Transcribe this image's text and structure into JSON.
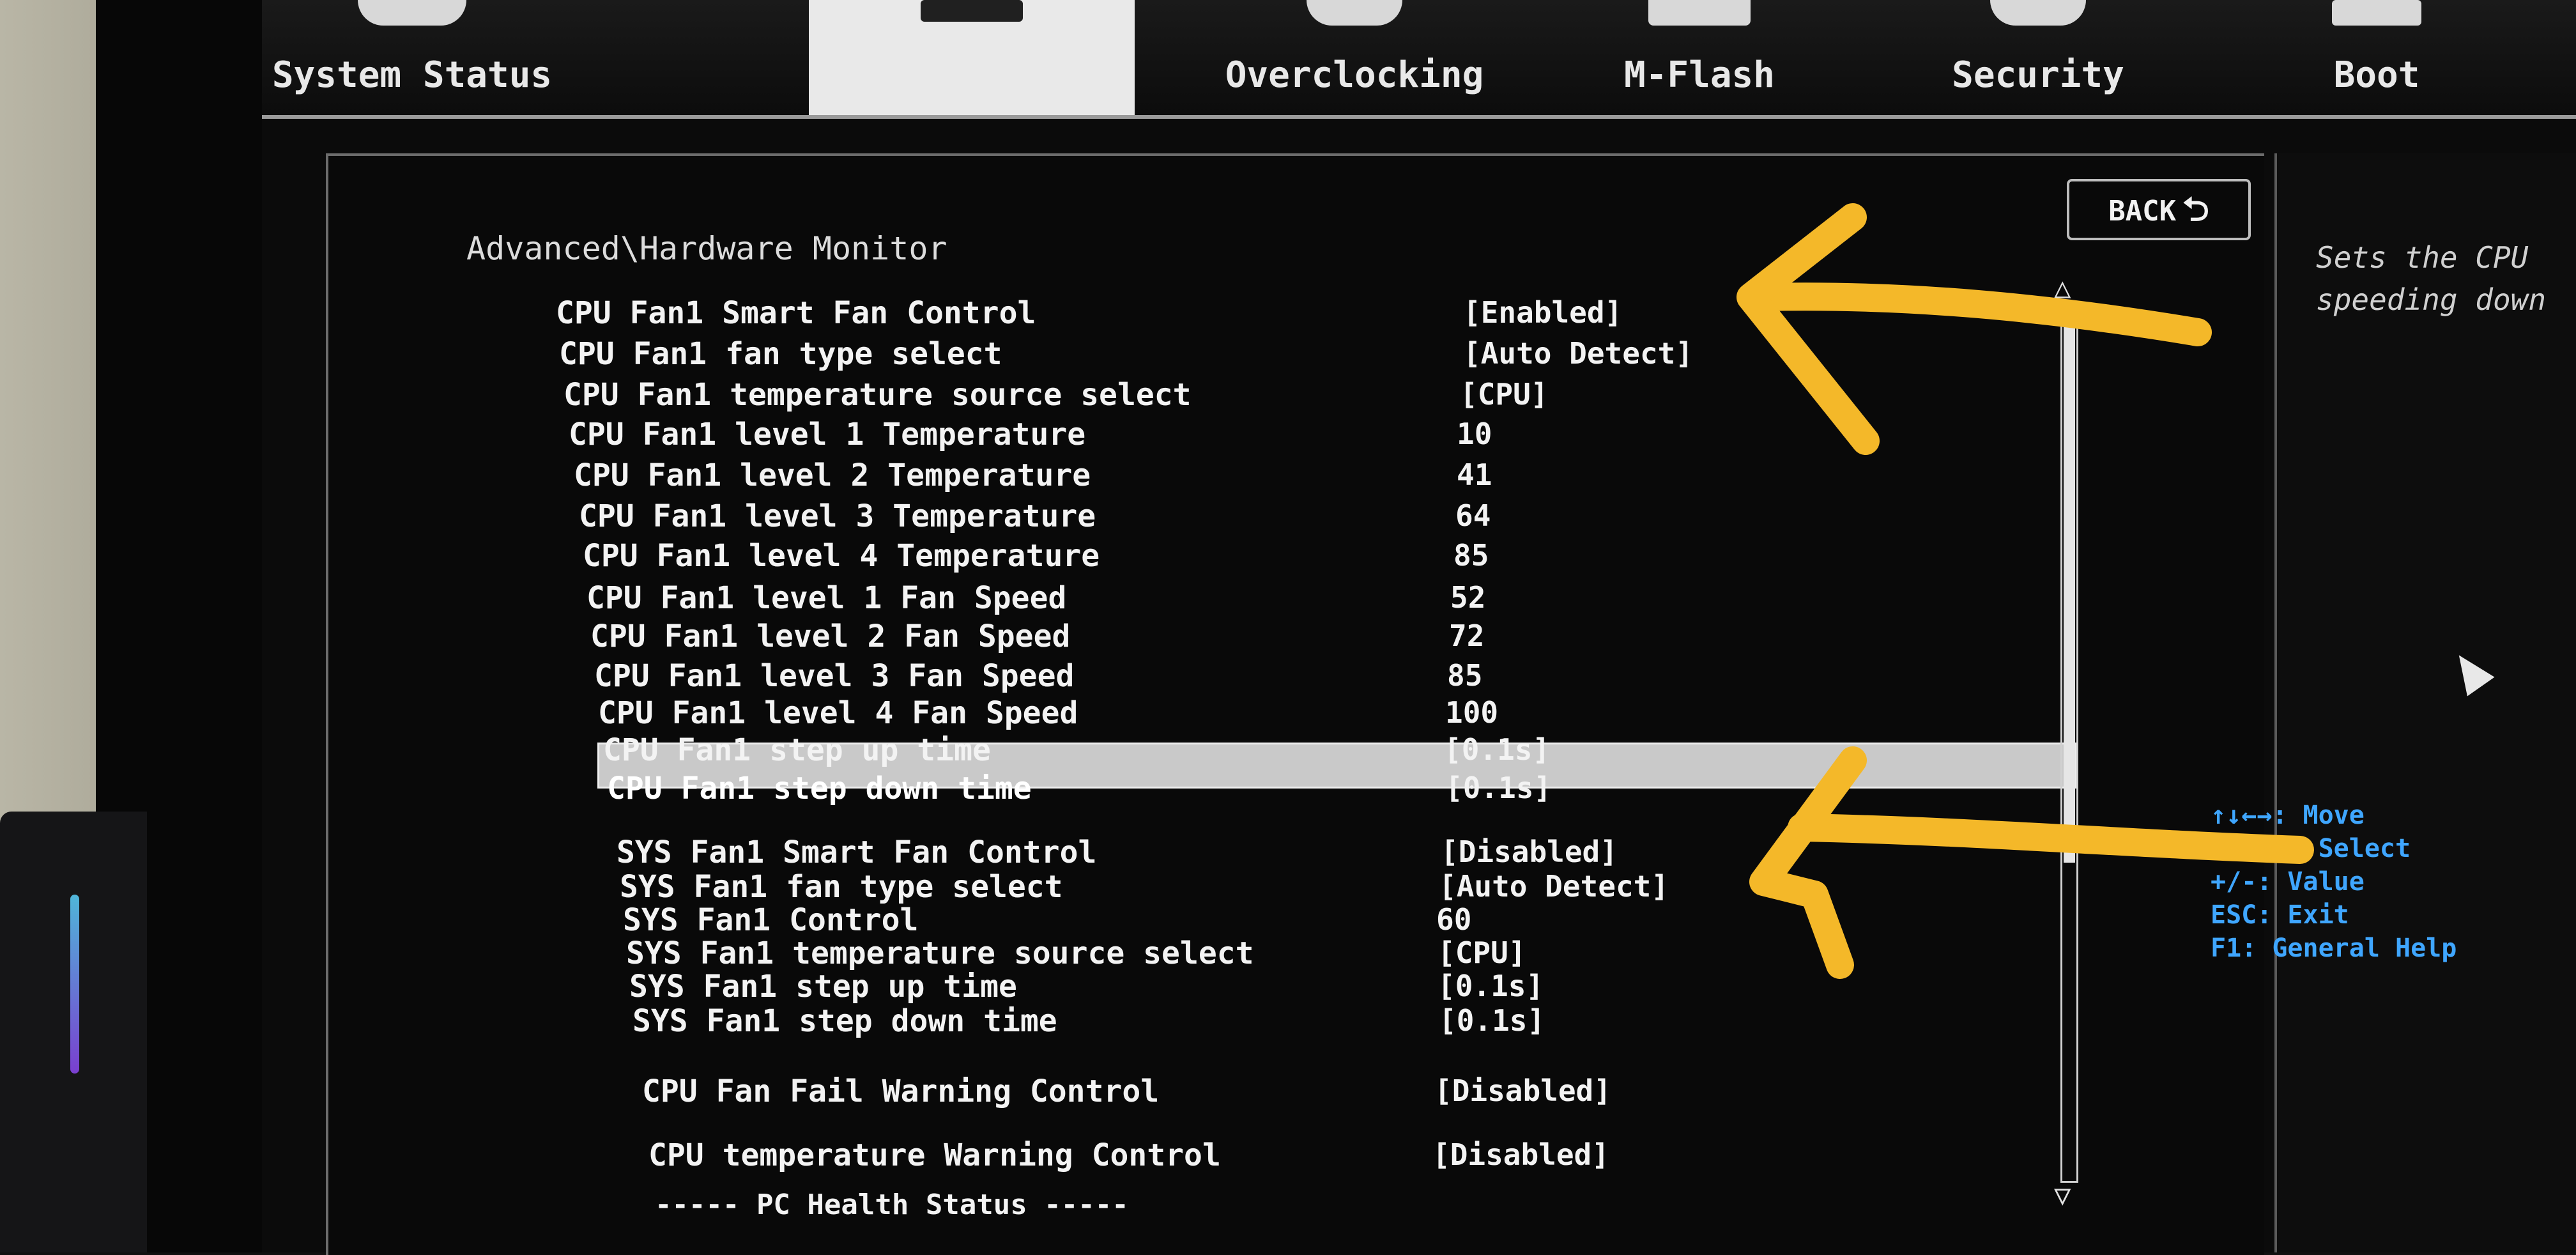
{
  "tabs": [
    {
      "label": "System Status",
      "active": false
    },
    {
      "label": "",
      "active": true
    },
    {
      "label": "Overclocking",
      "active": false
    },
    {
      "label": "M-Flash",
      "active": false
    },
    {
      "label": "Security",
      "active": false
    },
    {
      "label": "Boot",
      "active": false
    }
  ],
  "breadcrumb": "Advanced\\Hardware Monitor",
  "back_label": "BACK",
  "settings": [
    {
      "label": "CPU Fan1 Smart Fan Control",
      "value": "[Enabled]"
    },
    {
      "label": "CPU Fan1 fan type select",
      "value": "[Auto Detect]"
    },
    {
      "label": "CPU Fan1 temperature source select",
      "value": "[CPU]"
    },
    {
      "label": "CPU Fan1 level 1 Temperature",
      "value": "10"
    },
    {
      "label": "CPU Fan1 level 2 Temperature",
      "value": "41"
    },
    {
      "label": "CPU Fan1 level 3 Temperature",
      "value": "64"
    },
    {
      "label": "CPU Fan1 level 4 Temperature",
      "value": "85"
    },
    {
      "label": "CPU Fan1 level 1 Fan Speed",
      "value": "52"
    },
    {
      "label": "CPU Fan1 level 2 Fan Speed",
      "value": "72"
    },
    {
      "label": "CPU Fan1 level 3 Fan Speed",
      "value": "85"
    },
    {
      "label": "CPU Fan1 level 4 Fan Speed",
      "value": "100"
    },
    {
      "label": "CPU Fan1 step up time",
      "value": "[0.1s]"
    },
    {
      "label": "CPU Fan1 step down time",
      "value": "[0.1s]"
    },
    {
      "label": "SYS Fan1 Smart Fan Control",
      "value": "[Disabled]"
    },
    {
      "label": "SYS Fan1 fan type select",
      "value": "[Auto Detect]"
    },
    {
      "label": "SYS Fan1 Control",
      "value": "60"
    },
    {
      "label": "SYS Fan1 temperature source select",
      "value": "[CPU]"
    },
    {
      "label": "SYS Fan1 step up time",
      "value": "[0.1s]"
    },
    {
      "label": "SYS Fan1 step down time",
      "value": "[0.1s]"
    },
    {
      "label": "CPU Fan Fail Warning Control",
      "value": "[Disabled]"
    },
    {
      "label": "CPU temperature Warning Control",
      "value": "[Disabled]"
    }
  ],
  "section_header": "----- PC Health Status -----",
  "help_text": "Sets the CPU\nspeeding down",
  "key_help": [
    "↑↓←→: Move",
    "Enter: Select",
    "+/-: Value",
    "ESC: Exit",
    "F1: General Help"
  ],
  "colors": {
    "annotation_arrow": "#f4b829",
    "key_help": "#3fa6ff",
    "highlight": "#c9c9c9"
  }
}
